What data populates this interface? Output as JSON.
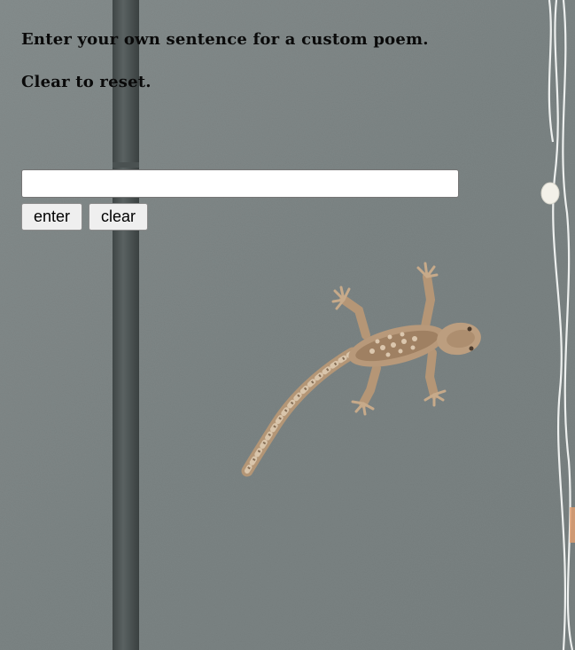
{
  "instructions": {
    "line1": "Enter your own sentence for a custom poem.",
    "line2": "Clear to reset."
  },
  "form": {
    "input_value": "",
    "enter_label": "enter",
    "clear_label": "clear"
  },
  "background": {
    "subject": "gecko on grey wall",
    "wall_color": "#7f8787",
    "pipe_color": "#4f5656"
  }
}
